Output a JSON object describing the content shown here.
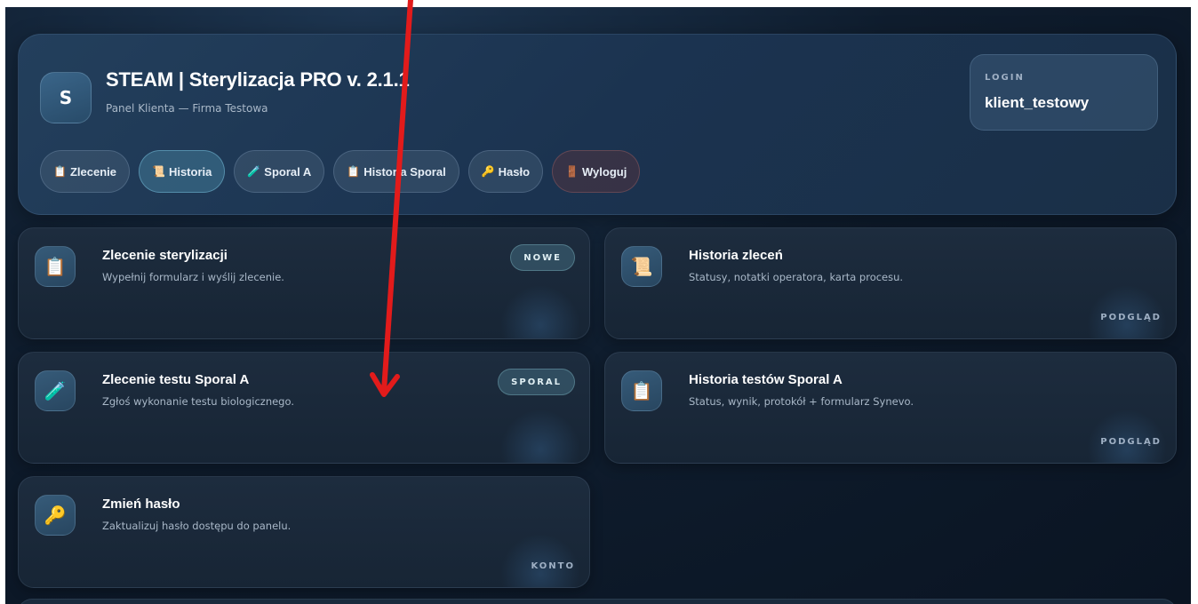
{
  "header": {
    "logo_letter": "S",
    "title": "STEAM | Sterylizacja PRO v. 2.1.1",
    "subtitle": "Panel Klienta — Firma Testowa",
    "login_label": "LOGIN",
    "login_value": "klient_testowy"
  },
  "nav": [
    {
      "icon": "📋",
      "label": "Zlecenie",
      "active": false
    },
    {
      "icon": "📜",
      "label": "Historia",
      "active": true
    },
    {
      "icon": "🧪",
      "label": "Sporal A",
      "active": false
    },
    {
      "icon": "📋",
      "label": "Historia Sporal",
      "active": false
    },
    {
      "icon": "🔑",
      "label": "Hasło",
      "active": false
    },
    {
      "icon": "🚪",
      "label": "Wyloguj",
      "active": false
    }
  ],
  "cards": [
    {
      "icon": "📋",
      "title": "Zlecenie sterylizacji",
      "desc": "Wypełnij formularz i wyślij zlecenie.",
      "badge": "NOWE",
      "tag": ""
    },
    {
      "icon": "📜",
      "title": "Historia zleceń",
      "desc": "Statusy, notatki operatora, karta procesu.",
      "badge": "",
      "tag": "PODGLĄD"
    },
    {
      "icon": "🧪",
      "title": "Zlecenie testu Sporal A",
      "desc": "Zgłoś wykonanie testu biologicznego.",
      "badge": "SPORAL",
      "tag": ""
    },
    {
      "icon": "📋",
      "title": "Historia testów Sporal A",
      "desc": "Status, wynik, protokół + formularz Synevo.",
      "badge": "",
      "tag": "PODGLĄD"
    },
    {
      "icon": "🔑",
      "title": "Zmień hasło",
      "desc": "Zaktualizuj hasło dostępu do panelu.",
      "badge": "",
      "tag": "KONTO"
    }
  ],
  "colors": {
    "background": "#0f1d2e",
    "accent_arrow": "#e21b1b",
    "card": "#1d2c3e"
  }
}
